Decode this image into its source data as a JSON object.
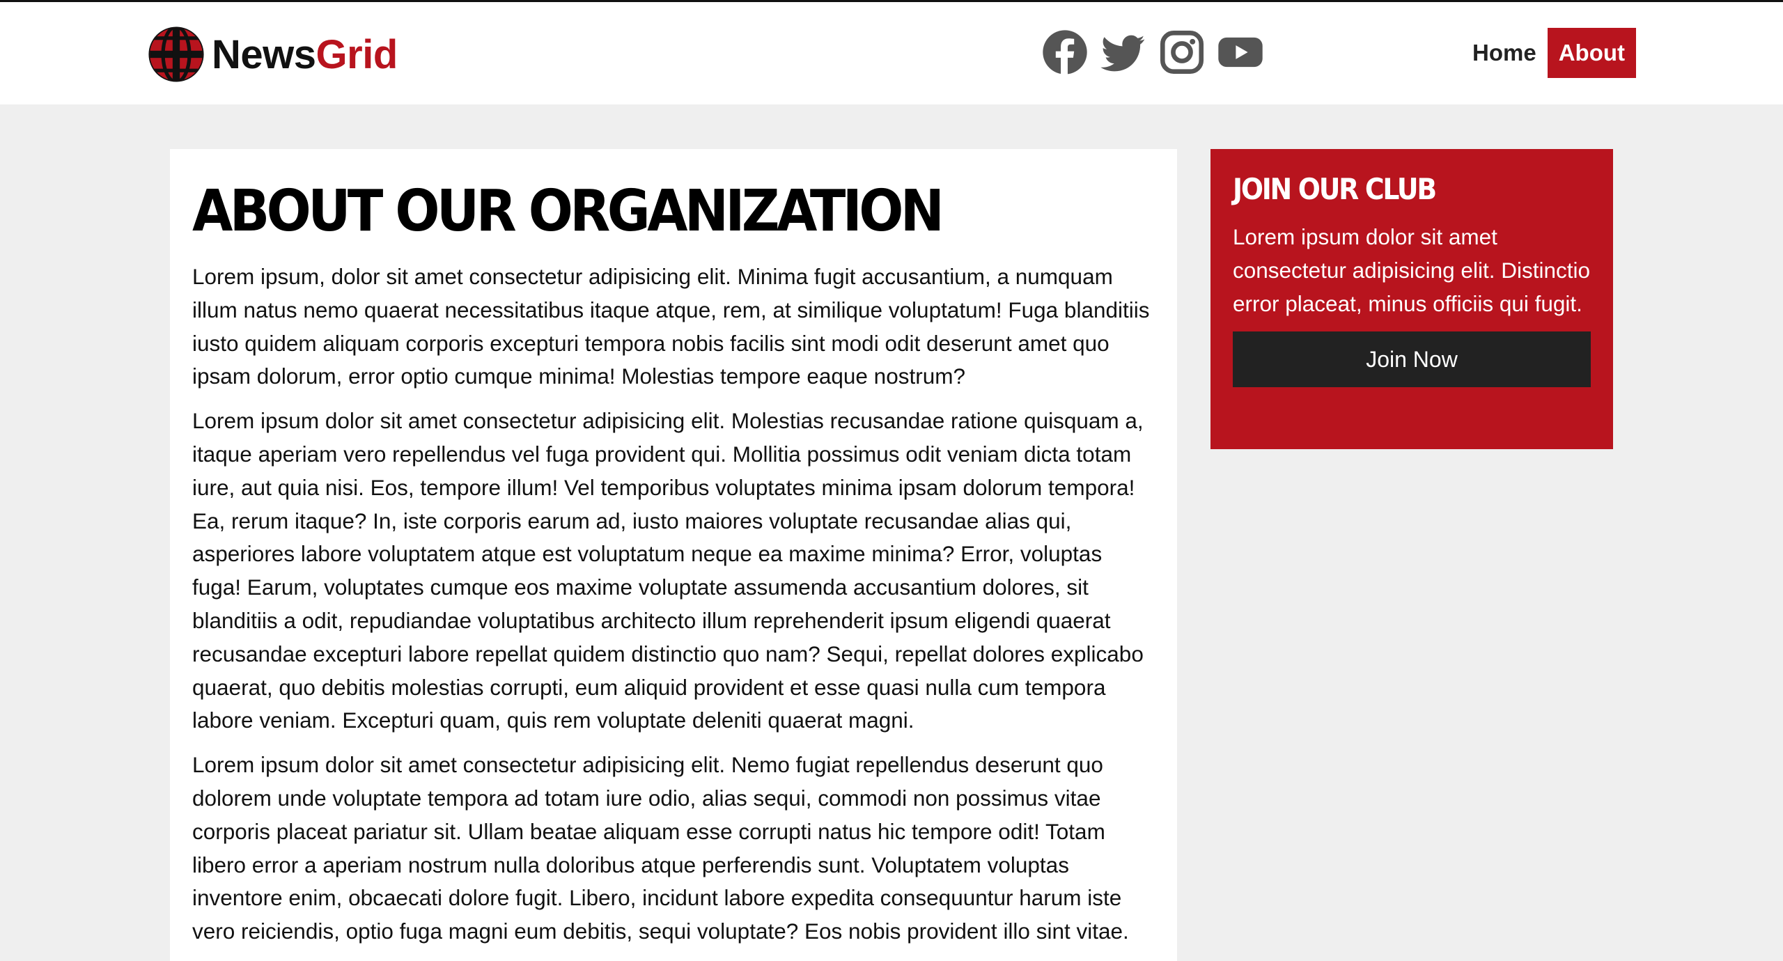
{
  "brand": {
    "name_part1": "News",
    "name_part2": "Grid",
    "accent_color": "#b8141e"
  },
  "social_icons": [
    "facebook-icon",
    "twitter-icon",
    "instagram-icon",
    "youtube-icon"
  ],
  "nav": {
    "items": [
      {
        "label": "Home",
        "active": false
      },
      {
        "label": "About",
        "active": true
      }
    ]
  },
  "article": {
    "title": "About Our Organization",
    "paragraphs": [
      "Lorem ipsum, dolor sit amet consectetur adipisicing elit. Minima fugit accusantium, a numquam illum natus nemo quaerat necessitatibus itaque atque, rem, at similique voluptatum! Fuga blanditiis iusto quidem aliquam corporis excepturi tempora nobis facilis sint modi odit deserunt amet quo ipsam dolorum, error optio cumque minima! Molestias tempore eaque nostrum?",
      "Lorem ipsum dolor sit amet consectetur adipisicing elit. Molestias recusandae ratione quisquam a, itaque aperiam vero repellendus vel fuga provident qui. Mollitia possimus odit veniam dicta totam iure, aut quia nisi. Eos, tempore illum! Vel temporibus voluptates minima ipsam dolorum tempora! Ea, rerum itaque? In, iste corporis earum ad, iusto maiores voluptate recusandae alias qui, asperiores labore voluptatem atque est voluptatum neque ea maxime minima? Error, voluptas fuga! Earum, voluptates cumque eos maxime voluptate assumenda accusantium dolores, sit blanditiis a odit, repudiandae voluptatibus architecto illum reprehenderit ipsum eligendi quaerat recusandae excepturi labore repellat quidem distinctio quo nam? Sequi, repellat dolores explicabo quaerat, quo debitis molestias corrupti, eum aliquid provident et esse quasi nulla cum tempora labore veniam. Excepturi quam, quis rem voluptate deleniti quaerat magni.",
      "Lorem ipsum dolor sit amet consectetur adipisicing elit. Nemo fugiat repellendus deserunt quo dolorem unde voluptate tempora ad totam iure odio, alias sequi, commodi non possimus vitae corporis placeat pariatur sit. Ullam beatae aliquam esse corrupti natus hic tempore odit! Totam libero error a aperiam nostrum nulla doloribus atque perferendis sunt. Voluptatem voluptas inventore enim, obcaecati dolore fugit. Libero, incidunt labore expedita consequuntur harum iste vero reiciendis, optio fuga magni eum debitis, sequi voluptate? Eos nobis provident illo sint vitae."
    ]
  },
  "sidebar": {
    "title": "Join Our Club",
    "text": "Lorem ipsum dolor sit amet consectetur adipisicing elit. Distinctio error placeat, minus officiis qui fugit.",
    "button_label": "Join Now"
  }
}
